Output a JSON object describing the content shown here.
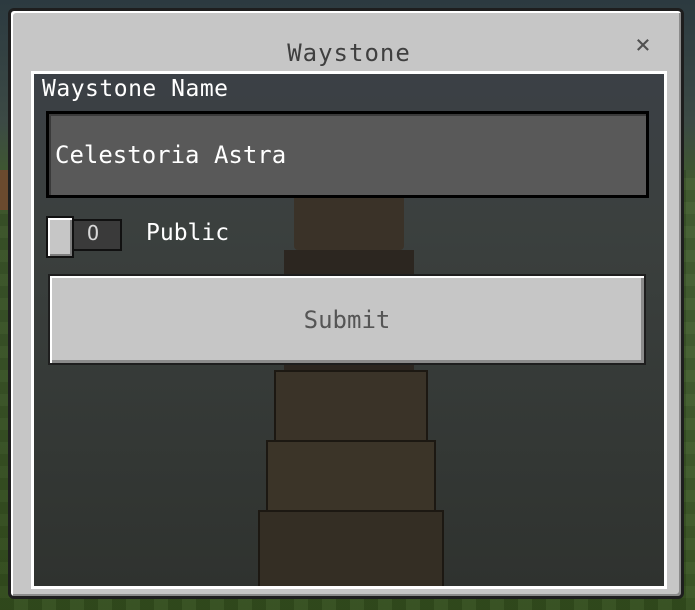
{
  "dialog": {
    "title": "Waystone",
    "close_glyph": "×",
    "close_icon": "close-icon"
  },
  "form": {
    "name_label": "Waystone Name",
    "name_value": "Celestoria Astra",
    "toggle": {
      "indicator": "O",
      "label": "Public",
      "state": "off"
    },
    "submit_label": "Submit"
  },
  "colors": {
    "dialog_bg": "#c6c6c6",
    "input_bg": "#595959",
    "text_light": "#ffffff",
    "text_dark": "#3f3f3f"
  }
}
